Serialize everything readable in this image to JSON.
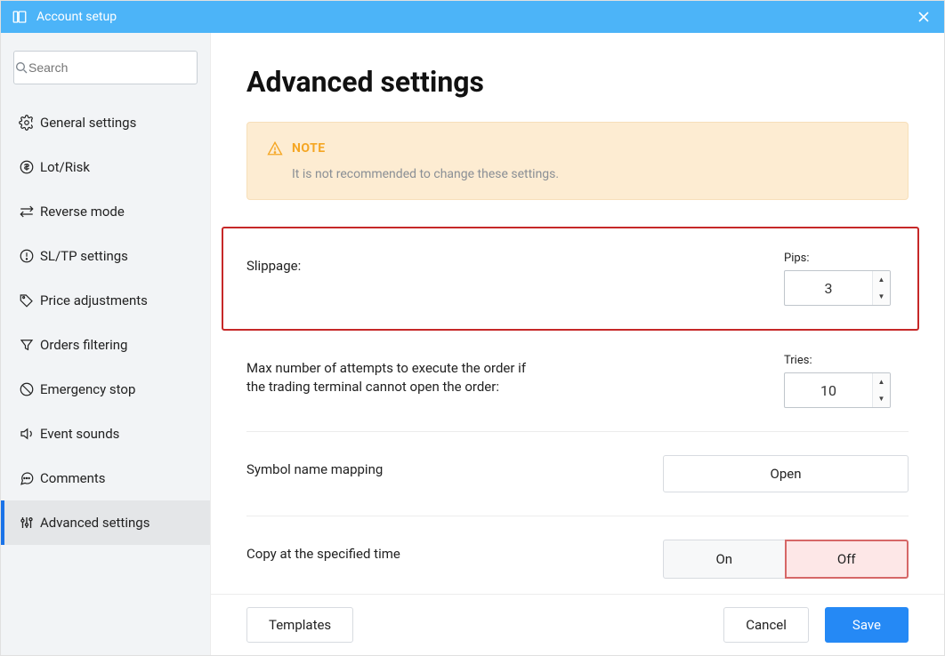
{
  "window": {
    "title": "Account setup"
  },
  "search": {
    "placeholder": "Search"
  },
  "sidebar": {
    "items": [
      {
        "label": "General settings",
        "icon": "gear-icon"
      },
      {
        "label": "Lot/Risk",
        "icon": "coin-icon"
      },
      {
        "label": "Reverse mode",
        "icon": "swap-icon"
      },
      {
        "label": "SL/TP settings",
        "icon": "alert-circle-icon"
      },
      {
        "label": "Price adjustments",
        "icon": "tag-icon"
      },
      {
        "label": "Orders filtering",
        "icon": "filter-icon"
      },
      {
        "label": "Emergency stop",
        "icon": "no-icon"
      },
      {
        "label": "Event sounds",
        "icon": "speaker-icon"
      },
      {
        "label": "Comments",
        "icon": "chat-icon"
      },
      {
        "label": "Advanced settings",
        "icon": "sliders-icon"
      }
    ],
    "active_index": 9
  },
  "page": {
    "title": "Advanced settings",
    "note": {
      "heading": "NOTE",
      "body": "It is not recommended to change these settings."
    },
    "slippage": {
      "label": "Slippage:",
      "field_title": "Pips:",
      "value": "3"
    },
    "max_attempts": {
      "label": "Max number of attempts to execute the order if the trading terminal cannot open the order:",
      "field_title": "Tries:",
      "value": "10"
    },
    "symbol_mapping": {
      "label": "Symbol name mapping",
      "button": "Open"
    },
    "copy_time": {
      "label": "Copy at the specified time",
      "on": "On",
      "off": "Off",
      "selected": "off"
    }
  },
  "footer": {
    "templates": "Templates",
    "cancel": "Cancel",
    "save": "Save"
  }
}
